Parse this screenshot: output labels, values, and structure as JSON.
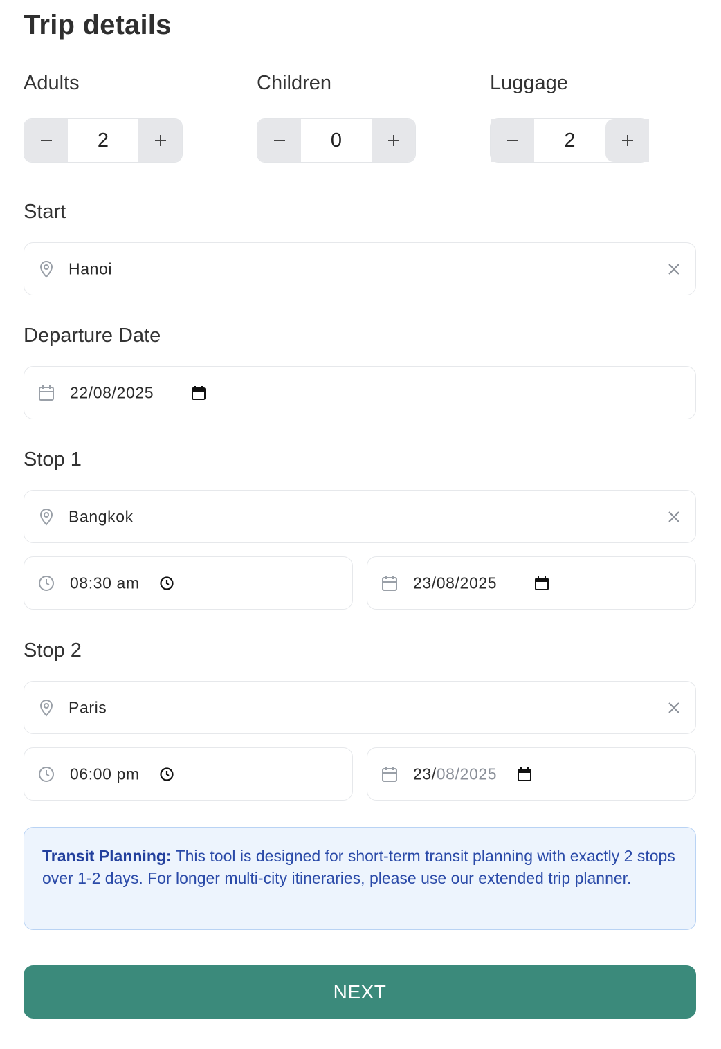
{
  "title": "Trip details",
  "counters": {
    "adults": {
      "label": "Adults",
      "value": "2",
      "minus": "−",
      "plus": "+"
    },
    "children": {
      "label": "Children",
      "value": "0",
      "minus": "−",
      "plus": "+"
    },
    "luggage": {
      "label": "Luggage",
      "value": "2",
      "minus": "−",
      "plus": "+"
    }
  },
  "start": {
    "label": "Start",
    "location": "Hanoi"
  },
  "departure": {
    "label": "Departure Date",
    "date": "22/08/2025"
  },
  "stop1": {
    "label": "Stop 1",
    "location": "Bangkok",
    "time": "08:30 am",
    "date": "23/08/2025"
  },
  "stop2": {
    "label": "Stop 2",
    "location": "Paris",
    "time": "06:00 pm",
    "date_day": "23/",
    "date_rest": "08/2025"
  },
  "info": {
    "heading": "Transit Planning:",
    "text": " This tool is designed for short-term transit planning with exactly 2 stops over 1-2 days. For longer multi-city itineraries, please use our extended trip planner."
  },
  "next_label": "NEXT",
  "colors": {
    "accent": "#3b8a7b",
    "info_bg": "#edf4fd",
    "info_text": "#2a4aa8"
  }
}
